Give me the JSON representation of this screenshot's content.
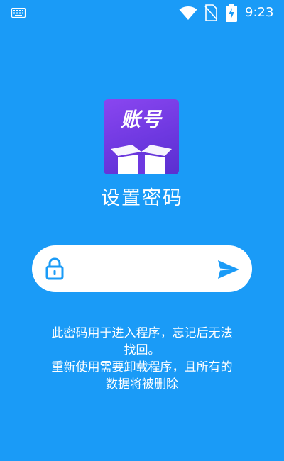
{
  "status_bar": {
    "time": "9:23",
    "icons": [
      "keyboard-icon",
      "wifi-icon",
      "no-sim-icon",
      "battery-charging-icon"
    ]
  },
  "app": {
    "logo_text": "账号"
  },
  "page": {
    "title": "设置密码"
  },
  "password_field": {
    "value": "",
    "placeholder": "",
    "leading_icon": "lock-icon",
    "trailing_icon": "send-icon"
  },
  "notice": {
    "lines": [
      "此密码用于进入程序，忘记后无法",
      "找回。",
      "重新使用需要卸载程序，且所有的",
      "数据将被删除"
    ]
  },
  "colors": {
    "background": "#1a9bf7",
    "accent": "#1a9bf7",
    "logo_gradient_start": "#8a46f0",
    "logo_gradient_end": "#5a2fd0",
    "field_background": "#ffffff",
    "text": "#ffffff"
  }
}
